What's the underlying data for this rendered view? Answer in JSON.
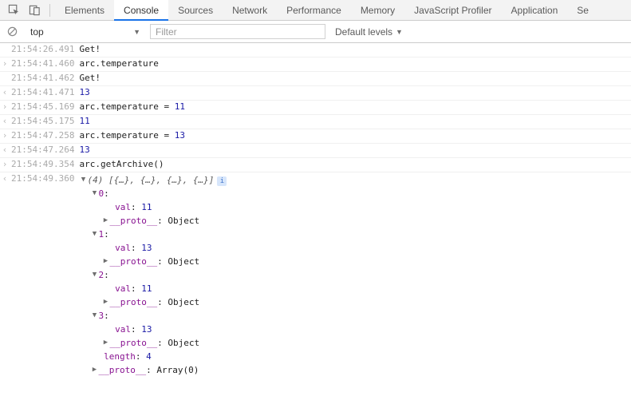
{
  "tabs": {
    "items": [
      "Elements",
      "Console",
      "Sources",
      "Network",
      "Performance",
      "Memory",
      "JavaScript Profiler",
      "Application",
      "Se"
    ],
    "active_index": 1
  },
  "toolbar": {
    "context": "top",
    "filter_placeholder": "Filter",
    "levels_label": "Default levels"
  },
  "rows": [
    {
      "dir": "none",
      "ts": "21:54:26.491",
      "kind": "text",
      "text": "Get!"
    },
    {
      "dir": "in",
      "ts": "21:54:41.460",
      "kind": "expr",
      "text": "arc.temperature"
    },
    {
      "dir": "none",
      "ts": "21:54:41.462",
      "kind": "text",
      "text": "Get!"
    },
    {
      "dir": "out",
      "ts": "21:54:41.471",
      "kind": "num",
      "text": "13"
    },
    {
      "dir": "in",
      "ts": "21:54:45.169",
      "kind": "assign",
      "lhs": "arc.temperature = ",
      "rhs": "11"
    },
    {
      "dir": "out",
      "ts": "21:54:45.175",
      "kind": "num",
      "text": "11"
    },
    {
      "dir": "in",
      "ts": "21:54:47.258",
      "kind": "assign",
      "lhs": "arc.temperature = ",
      "rhs": "13"
    },
    {
      "dir": "out",
      "ts": "21:54:47.264",
      "kind": "num",
      "text": "13"
    },
    {
      "dir": "in",
      "ts": "21:54:49.354",
      "kind": "expr",
      "text": "arc.getArchive()"
    }
  ],
  "obj": {
    "ts": "21:54:49.360",
    "summary": "(4) [{…}, {…}, {…}, {…}]",
    "entries": [
      {
        "idx": "0",
        "val": "11"
      },
      {
        "idx": "1",
        "val": "13"
      },
      {
        "idx": "2",
        "val": "11"
      },
      {
        "idx": "3",
        "val": "13"
      }
    ],
    "length_label": "length",
    "length_value": "4",
    "proto_label": "__proto__",
    "proto_obj": "Object",
    "proto_arr": "Array(0)",
    "val_label": "val"
  }
}
